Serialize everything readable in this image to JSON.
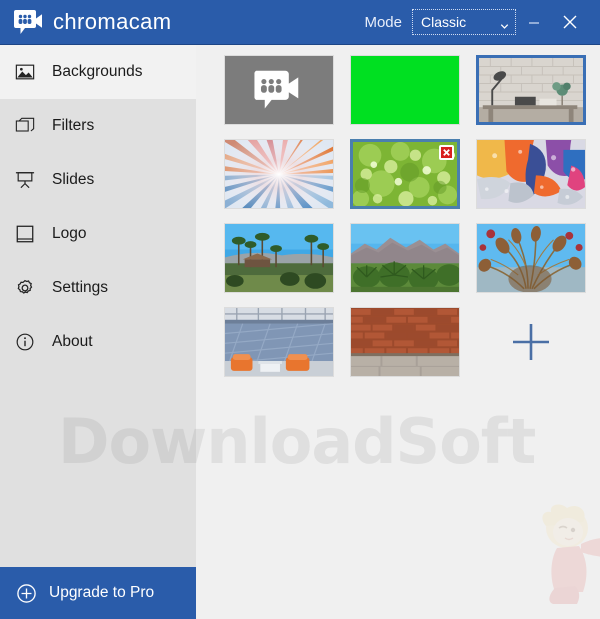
{
  "window": {
    "brand_name": "chromacam",
    "brand_icon": "chromacam-speech-video-icon",
    "mode_label": "Mode",
    "mode_value": "Classic",
    "mode_options": [
      "Classic"
    ],
    "minimize_icon": "minimize-icon",
    "close_icon": "close-icon",
    "titlebar_color": "#2a5caa"
  },
  "sidebar": {
    "background_color": "#e0e0e0",
    "active_item_color": "#f2f2f2",
    "items": [
      {
        "label": "Backgrounds",
        "icon": "image-icon",
        "active": true
      },
      {
        "label": "Filters",
        "icon": "layers-icon",
        "active": false
      },
      {
        "label": "Slides",
        "icon": "presentation-icon",
        "active": false
      },
      {
        "label": "Logo",
        "icon": "square-logo-icon",
        "active": false
      },
      {
        "label": "Settings",
        "icon": "gear-icon",
        "active": false
      },
      {
        "label": "About",
        "icon": "info-icon",
        "active": false
      }
    ],
    "upgrade": {
      "label": "Upgrade to Pro",
      "icon": "plus-circle-icon",
      "color": "#2a5caa"
    }
  },
  "main": {
    "background_color": "#f0f0f0",
    "accent_color": "#3a6fb5",
    "add_button": {
      "icon": "plus-icon",
      "label": ""
    },
    "thumbnails": [
      {
        "name": "chromacam-logo-tile",
        "art": "logo-gray",
        "selected": false,
        "hovered": false
      },
      {
        "name": "green-screen-tile",
        "art": "green",
        "selected": false,
        "hovered": false
      },
      {
        "name": "desk-brick-wall-tile",
        "art": "desk",
        "selected": true,
        "hovered": false
      },
      {
        "name": "sunburst-rays-tile",
        "art": "sunburst",
        "selected": false,
        "hovered": false
      },
      {
        "name": "green-bokeh-tile",
        "art": "bokeh",
        "selected": false,
        "hovered": true,
        "delete_badge": "delete-icon"
      },
      {
        "name": "abstract-color-art-tile",
        "art": "abstract",
        "selected": false,
        "hovered": false
      },
      {
        "name": "palm-desert-tile",
        "art": "palms",
        "selected": false,
        "hovered": false
      },
      {
        "name": "mountain-palms-tile",
        "art": "mountain",
        "selected": false,
        "hovered": false
      },
      {
        "name": "palm-closeup-tile",
        "art": "palmclose",
        "selected": false,
        "hovered": false
      },
      {
        "name": "modern-lounge-tile",
        "art": "lounge",
        "selected": false,
        "hovered": false
      },
      {
        "name": "brick-wall-tile",
        "art": "brick",
        "selected": false,
        "hovered": false
      }
    ]
  },
  "watermark": {
    "text": "DownloadSoft",
    "mascot": "anime-mascot-watermark"
  }
}
